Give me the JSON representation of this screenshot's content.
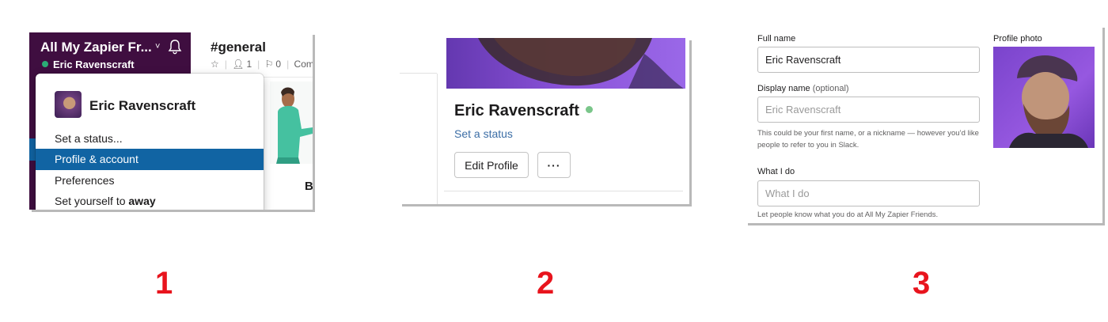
{
  "panel1": {
    "workspace_name": "All My Zapier Fr...",
    "caret": "˅",
    "user_name": "Eric Ravenscraft",
    "channel": "#general",
    "meta_members": "1",
    "meta_pins": "0",
    "meta_more": "Com",
    "partial_text": "B",
    "menu": {
      "name": "Eric Ravenscraft",
      "items": [
        {
          "label": "Set a status..."
        },
        {
          "label": "Profile & account"
        },
        {
          "label": "Preferences"
        },
        {
          "label_prefix": "Set yourself to ",
          "label_bold": "away"
        }
      ]
    }
  },
  "panel2": {
    "name": "Eric Ravenscraft",
    "status_link": "Set a status",
    "edit_button": "Edit Profile",
    "more_button": "···"
  },
  "panel3": {
    "full_name_label": "Full name",
    "full_name_value": "Eric Ravenscraft",
    "display_name_label": "Display name",
    "display_name_optional": "(optional)",
    "display_name_placeholder": "Eric Ravenscraft",
    "display_name_hint": "This could be your first name, or a nickname — however you’d like people to refer to you in Slack.",
    "what_i_do_label": "What I do",
    "what_i_do_placeholder": "What I do",
    "what_i_do_hint": "Let people know what you do at All My Zapier Friends.",
    "profile_photo_label": "Profile photo"
  },
  "steps": [
    "1",
    "2",
    "3"
  ],
  "colors": {
    "sidebar": "#3f0e40",
    "selection": "#1164a3",
    "online": "#2bac76",
    "step_numbers": "#e8141d",
    "photo_purple": "#8a52d8"
  }
}
